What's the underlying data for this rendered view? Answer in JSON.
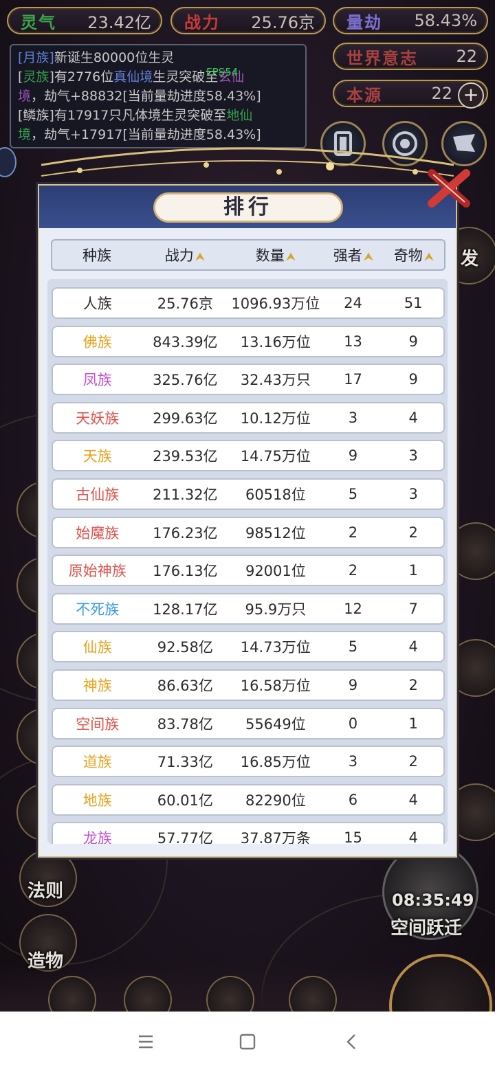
{
  "resources": [
    {
      "name": "灵气",
      "value": "23.42亿",
      "color": "#3aa64d"
    },
    {
      "name": "战力",
      "value": "25.76京",
      "color": "#c73a3a"
    },
    {
      "name": "量劫",
      "value": "58.43%",
      "color": "#7d6fd0"
    },
    {
      "name": "世界意志",
      "value": "22",
      "color": "#a8413f"
    },
    {
      "name": "本源",
      "value": "22",
      "color": "#a8413f"
    }
  ],
  "log": {
    "line1_tag": "[月族]",
    "line1_text": "新诞生80000位生灵",
    "line2_open": "[",
    "line2_race": "灵族",
    "line2_close": "]",
    "line2_mid": "有2776位",
    "line2_realm": "真仙境",
    "line2_text": "生灵突破至",
    "line2_target": "玄仙",
    "line3_target": "境",
    "line3_text": "，劫气+88832[当前量劫进度58.43%]",
    "line4_text": "[鳞族]有17917只凡体境生灵突破至",
    "line4_target": "地仙",
    "line5_target": "境",
    "line5_text": "，劫气+17917[当前量劫进度58.43%]"
  },
  "fps": "FPS54",
  "modal": {
    "title": "排行",
    "headers": {
      "race": "种族",
      "power": "战力",
      "count": "数量",
      "strong": "强者",
      "item": "奇物"
    },
    "rows": [
      {
        "race": "人族",
        "power": "25.76京",
        "count": "1096.93万位",
        "strong": "24",
        "item": "51",
        "color": "#2b2b2b"
      },
      {
        "race": "佛族",
        "power": "843.39亿",
        "count": "13.16万位",
        "strong": "13",
        "item": "9",
        "color": "#e8a21c"
      },
      {
        "race": "凤族",
        "power": "325.76亿",
        "count": "32.43万只",
        "strong": "17",
        "item": "9",
        "color": "#c44fd4"
      },
      {
        "race": "天妖族",
        "power": "299.63亿",
        "count": "10.12万位",
        "strong": "3",
        "item": "4",
        "color": "#e0524a"
      },
      {
        "race": "天族",
        "power": "239.53亿",
        "count": "14.75万位",
        "strong": "9",
        "item": "3",
        "color": "#e8a21c"
      },
      {
        "race": "古仙族",
        "power": "211.32亿",
        "count": "60518位",
        "strong": "5",
        "item": "3",
        "color": "#e0524a"
      },
      {
        "race": "始魔族",
        "power": "176.23亿",
        "count": "98512位",
        "strong": "2",
        "item": "2",
        "color": "#e0524a"
      },
      {
        "race": "原始神族",
        "power": "176.13亿",
        "count": "92001位",
        "strong": "2",
        "item": "1",
        "color": "#e0524a"
      },
      {
        "race": "不死族",
        "power": "128.17亿",
        "count": "95.9万只",
        "strong": "12",
        "item": "7",
        "color": "#3b9be0"
      },
      {
        "race": "仙族",
        "power": "92.58亿",
        "count": "14.73万位",
        "strong": "5",
        "item": "4",
        "color": "#e8a21c"
      },
      {
        "race": "神族",
        "power": "86.63亿",
        "count": "16.58万位",
        "strong": "9",
        "item": "2",
        "color": "#e8a21c"
      },
      {
        "race": "空间族",
        "power": "83.78亿",
        "count": "55649位",
        "strong": "0",
        "item": "1",
        "color": "#e0524a"
      },
      {
        "race": "道族",
        "power": "71.33亿",
        "count": "16.85万位",
        "strong": "3",
        "item": "2",
        "color": "#e8a21c"
      },
      {
        "race": "地族",
        "power": "60.01亿",
        "count": "82290位",
        "strong": "6",
        "item": "4",
        "color": "#e8a21c"
      },
      {
        "race": "龙族",
        "power": "57.77亿",
        "count": "37.87万条",
        "strong": "15",
        "item": "4",
        "color": "#c44fd4"
      }
    ]
  },
  "side_buttons": {
    "fa_ze": "法则",
    "zao_wu": "造物"
  },
  "timer": "08:35:49",
  "space_jump": "空间跃迁",
  "peek_labels": {
    "right_fa": "发"
  },
  "nav": {
    "menu_icon": "menu-icon",
    "home_icon": "home-square-icon",
    "back_icon": "back-chevron-icon"
  }
}
